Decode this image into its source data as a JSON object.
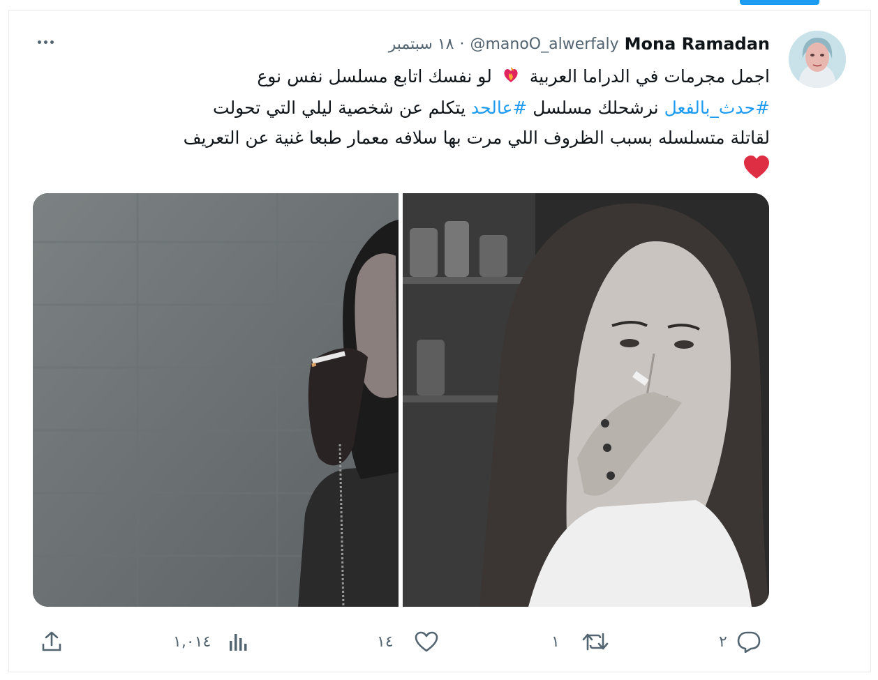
{
  "tweet": {
    "author_name": "Mona Ramadan",
    "handle": "@manoO_alwerfaly",
    "separator": "·",
    "date": "١٨ سبتمبر",
    "text_line1_a": "اجمل مجرمات في الدراما العربية",
    "text_line1_b": "لو نفسك اتابع مسلسل نفس نوع",
    "hashtag1": "#حدث_بالفعل",
    "text_line2_a": "نرشحلك مسلسل",
    "hashtag2": "#عالحد",
    "text_line2_b": "يتكلم عن شخصية ليلي التي تحولت",
    "text_line3": "لقاتلة متسلسله بسبب الظروف اللي مرت بها سلافه معمار طبعا غنية عن التعريف",
    "emoji_fire": "fire-heart-emoji",
    "emoji_heart": "red-heart-emoji"
  },
  "actions": {
    "reply_count": "٢",
    "retweet_count": "١",
    "like_count": "١٤",
    "views_count": "١,٠١٤"
  },
  "icons": {
    "reply": "reply-icon",
    "retweet": "retweet-icon",
    "like": "like-icon",
    "views": "views-icon",
    "share": "share-icon",
    "more": "more-icon"
  },
  "colors": {
    "accent": "#1d9bf0",
    "text": "#0f1419",
    "muted": "#536471",
    "heart": "#e0245e"
  }
}
